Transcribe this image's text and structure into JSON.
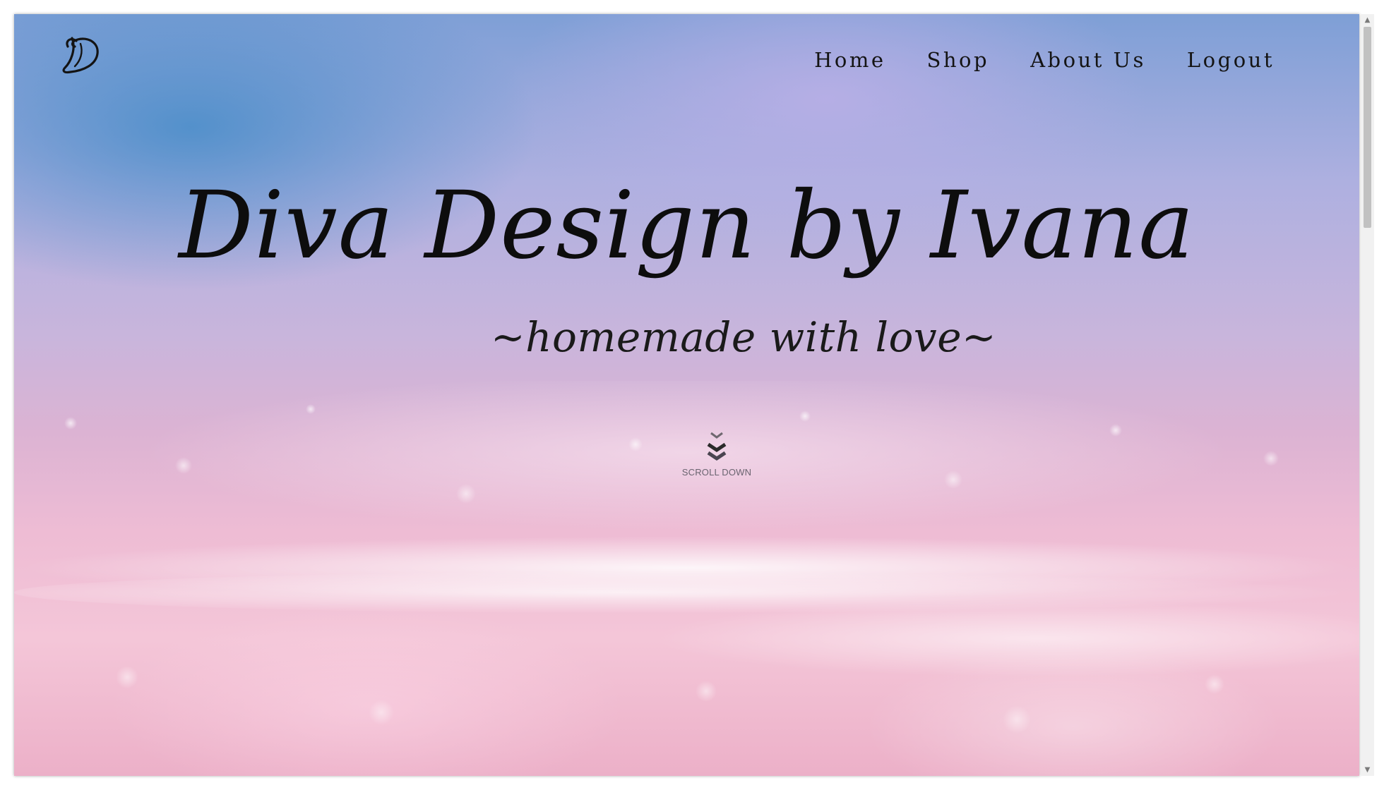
{
  "site": {
    "logo_icon": "script-d-monogram-icon"
  },
  "nav": {
    "items": [
      {
        "label": "Home"
      },
      {
        "label": "Shop"
      },
      {
        "label": "About Us"
      },
      {
        "label": "Logout"
      }
    ]
  },
  "hero": {
    "title": "Diva Design by Ivana",
    "subtitle": "~homemade with love~",
    "scroll_label": "SCROLL DOWN",
    "scroll_icon": "double-chevron-down-icon"
  },
  "scrollbar": {
    "up_icon": "scroll-up-arrow-icon",
    "down_icon": "scroll-down-arrow-icon"
  },
  "colors": {
    "text": "#141414",
    "sky_blue": "#7e9fd6",
    "lavender": "#c8b5dc",
    "pink": "#f4c6d8"
  }
}
